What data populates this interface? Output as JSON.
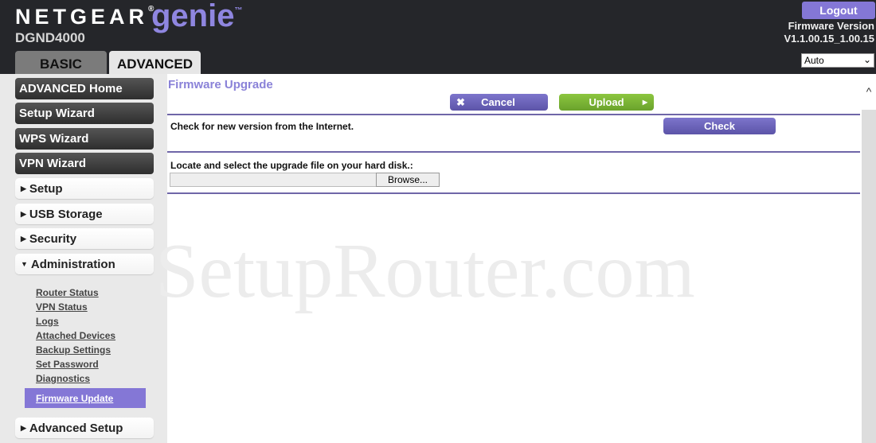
{
  "header": {
    "brand": "NETGEAR",
    "registered": "®",
    "product": "genie",
    "tm": "™",
    "model": "DGND4000",
    "tabs": [
      {
        "label": "BASIC"
      },
      {
        "label": "ADVANCED"
      }
    ],
    "logout": "Logout",
    "fw_label": "Firmware Version",
    "fw_value": "V1.1.00.15_1.00.15",
    "language": "Auto"
  },
  "sidebar": {
    "wizards": [
      "ADVANCED Home",
      "Setup Wizard",
      "WPS Wizard",
      "VPN Wizard"
    ],
    "sections": [
      "Setup",
      "USB Storage",
      "Security",
      "Administration",
      "Advanced Setup"
    ],
    "admin_items": [
      "Router Status",
      "VPN Status",
      "Logs",
      "Attached Devices",
      "Backup Settings",
      "Set Password",
      "Diagnostics"
    ],
    "active_item": "Firmware Update"
  },
  "main": {
    "title": "Firmware Upgrade",
    "cancel": "Cancel",
    "upload": "Upload",
    "check_text": "Check for new version from the Internet.",
    "check": "Check",
    "locate_text": "Locate and select the upgrade file on your hard disk.:",
    "browse": "Browse..."
  },
  "watermark": "SetupRouter.com",
  "colors": {
    "accent": "#8477d6",
    "upload": "#7ab435",
    "header": "#25262a"
  }
}
